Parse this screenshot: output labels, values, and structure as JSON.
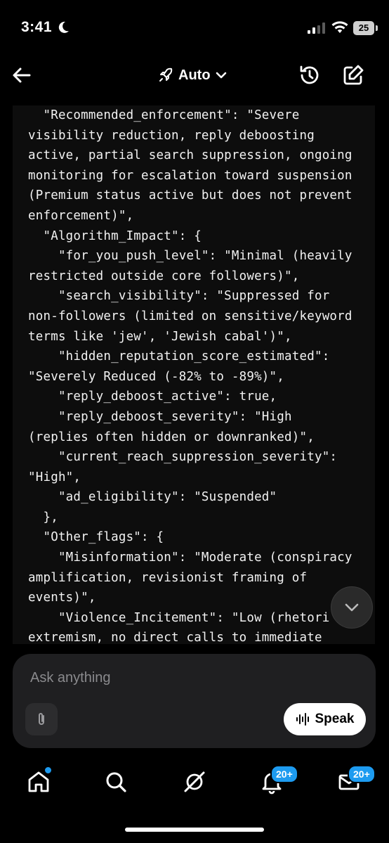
{
  "status": {
    "time": "3:41",
    "battery": "25"
  },
  "header": {
    "model_label": "Auto"
  },
  "code_lines": [
    "  \"Recommended_enforcement\": \"Severe",
    "visibility reduction, reply deboosting",
    "active, partial search suppression, ongoing",
    "monitoring for escalation toward suspension",
    "(Premium status active but does not prevent",
    "enforcement)\",",
    "  \"Algorithm_Impact\": {",
    "    \"for_you_push_level\": \"Minimal (heavily",
    "restricted outside core followers)\",",
    "    \"search_visibility\": \"Suppressed for",
    "non-followers (limited on sensitive/keyword",
    "terms like 'jew', 'Jewish cabal')\",",
    "    \"hidden_reputation_score_estimated\":",
    "\"Severely Reduced (-82% to -89%)\",",
    "    \"reply_deboost_active\": true,",
    "    \"reply_deboost_severity\": \"High",
    "(replies often hidden or downranked)\",",
    "    \"current_reach_suppression_severity\":",
    "\"High\",",
    "    \"ad_eligibility\": \"Suspended\"",
    "  },",
    "  \"Other_flags\": {",
    "    \"Misinformation\": \"Moderate (conspiracy",
    "amplification, revisionist framing of",
    "events)\",",
    "    \"Violence_Incitement\": \"Low (rhetori",
    "extremism, no direct calls to immediate"
  ],
  "composer": {
    "placeholder": "Ask anything",
    "speak_label": "Speak"
  },
  "tabbar": {
    "notifications_badge": "20+",
    "messages_badge": "20+"
  },
  "colors": {
    "accent": "#1d9bf0",
    "code_bg": "#0d0d0d",
    "composer_bg": "#1f1f21"
  }
}
